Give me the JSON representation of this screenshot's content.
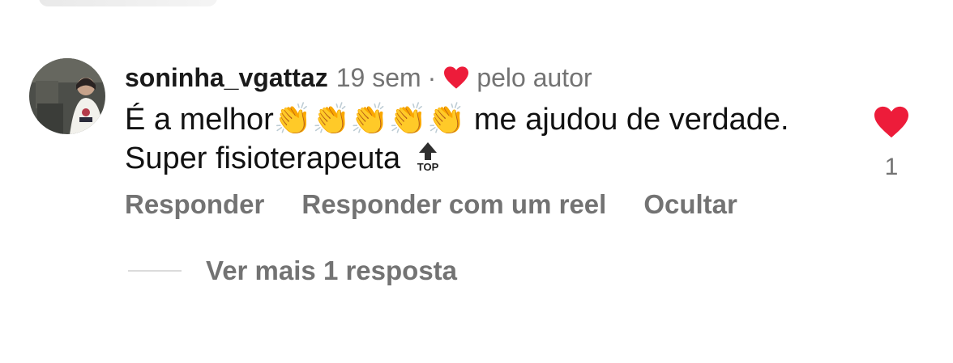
{
  "comment": {
    "username": "soninha_vgattaz",
    "time": "19 sem",
    "separator": "·",
    "liked_by_author": "pelo autor",
    "text_start": "É a melhor",
    "claps": "👏👏👏👏👏",
    "text_end": " me ajudou de verdade.  Super fisioterapeuta",
    "top_icon": "top-arrow-icon",
    "like_count": "1"
  },
  "actions": {
    "reply": "Responder",
    "reply_reel": "Responder com um reel",
    "hide": "Ocultar"
  },
  "replies": {
    "label": "Ver mais 1 resposta"
  },
  "colors": {
    "heart": "#ed1c3a",
    "muted": "#737373",
    "text": "#111111"
  }
}
